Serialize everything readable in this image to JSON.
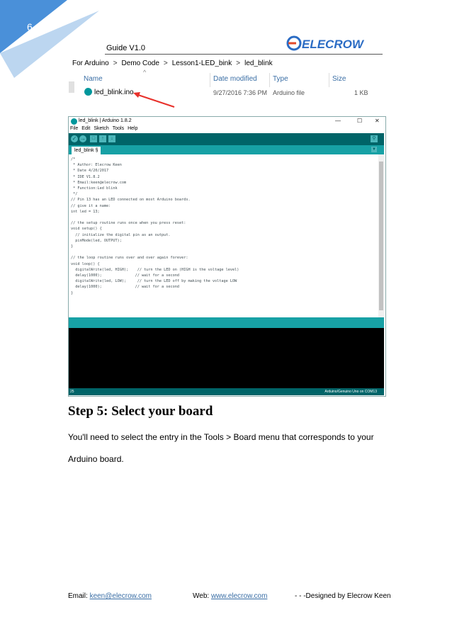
{
  "page": {
    "number": "6",
    "guide": "Guide  V1.0",
    "logo_text": "ELECROW"
  },
  "explorer": {
    "breadcrumb": [
      "For Arduino",
      "Demo Code",
      "Lesson1-LED_bink",
      "led_blink"
    ],
    "columns": [
      "Name",
      "Date modified",
      "Type",
      "Size"
    ],
    "file": {
      "name": "led_blink.ino",
      "date": "9/27/2016 7:36 PM",
      "type": "Arduino file",
      "size": "1 KB"
    }
  },
  "ide": {
    "title": "led_blink | Arduino 1.8.2",
    "menu": [
      "File",
      "Edit",
      "Sketch",
      "Tools",
      "Help"
    ],
    "tab": "led_blink §",
    "code": [
      "/*",
      " * Author: Elecrow Keen",
      " * Date 4/20/2017",
      " * IDE V1.8.2",
      " * Email:keen@elecrow.com",
      " * Function:Led blink",
      " */",
      "// Pin 13 has an LED connected on most Arduino boards.",
      "// give it a name:",
      "int led = 13;",
      "",
      "// the setup routine runs once when you press reset:",
      "void setup() {",
      "  // initialize the digital pin as an output.",
      "  pinMode(led, OUTPUT);",
      "}",
      "",
      "// the loop routine runs over and over again forever:",
      "void loop() {",
      "  digitalWrite(led, HIGH);    // turn the LED on (HIGH is the voltage level)",
      "  delay(1000);               // wait for a second",
      "  digitalWrite(led, LOW);     // turn the LED off by making the voltage LOW",
      "  delay(1000);               // wait for a second",
      "}"
    ],
    "status_line": "25",
    "status_board": "Arduino/Genuino Uno on COM13"
  },
  "content": {
    "step_title": "Step 5: Select your board",
    "para1": "You'll need to select the entry in the Tools > Board menu that corresponds to your",
    "para2": "Arduino board."
  },
  "footer": {
    "email_label": "Email: ",
    "email": "keen@elecrow.com",
    "web_label": "Web: ",
    "web": "www.elecrow.com",
    "designed": "- - -Designed by ",
    "author": "Elecrow Keen"
  },
  "colors": {
    "accent": "#4a90d9",
    "arduino_dark": "#006468",
    "arduino_teal": "#17a1a5",
    "link": "#3a6ea5"
  }
}
